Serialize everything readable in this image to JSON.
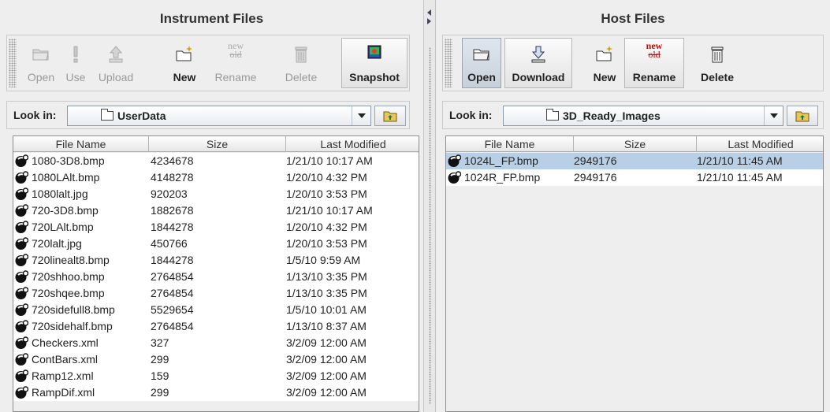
{
  "left_pane": {
    "title": "Instrument Files",
    "toolbar": {
      "open": "Open",
      "use": "Use",
      "upload": "Upload",
      "new": "New",
      "rename": "Rename",
      "rename_icon_new": "new",
      "rename_icon_old": "old",
      "delete": "Delete",
      "snapshot": "Snapshot"
    },
    "look_in_label": "Look in:",
    "look_in_value": "UserData",
    "table": {
      "columns": [
        "File Name",
        "Size",
        "Last Modified"
      ],
      "rows": [
        {
          "name": "1080-3D8.bmp",
          "size": "4234678",
          "modified": "1/21/10 10:17 AM"
        },
        {
          "name": "1080LAlt.bmp",
          "size": "4148278",
          "modified": "1/20/10 4:32 PM"
        },
        {
          "name": "1080lalt.jpg",
          "size": "920203",
          "modified": "1/20/10 3:53 PM"
        },
        {
          "name": "720-3D8.bmp",
          "size": "1882678",
          "modified": "1/21/10 10:17 AM"
        },
        {
          "name": "720LAlt.bmp",
          "size": "1844278",
          "modified": "1/20/10 4:32 PM"
        },
        {
          "name": "720lalt.jpg",
          "size": "450766",
          "modified": "1/20/10 3:53 PM"
        },
        {
          "name": "720linealt8.bmp",
          "size": "1844278",
          "modified": "1/5/10 9:59 AM"
        },
        {
          "name": "720shhoo.bmp",
          "size": "2764854",
          "modified": "1/13/10 3:35 PM"
        },
        {
          "name": "720shqee.bmp",
          "size": "2764854",
          "modified": "1/13/10 3:35 PM"
        },
        {
          "name": "720sidefull8.bmp",
          "size": "5529654",
          "modified": "1/5/10 10:01 AM"
        },
        {
          "name": "720sidehalf.bmp",
          "size": "2764854",
          "modified": "1/13/10 8:37 AM"
        },
        {
          "name": "Checkers.xml",
          "size": "327",
          "modified": "3/2/09 12:00 AM"
        },
        {
          "name": "ContBars.xml",
          "size": "299",
          "modified": "3/2/09 12:00 AM"
        },
        {
          "name": "Ramp12.xml",
          "size": "159",
          "modified": "3/2/09 12:00 AM"
        },
        {
          "name": "RampDif.xml",
          "size": "299",
          "modified": "3/2/09 12:00 AM"
        }
      ]
    }
  },
  "right_pane": {
    "title": "Host Files",
    "toolbar": {
      "open": "Open",
      "download": "Download",
      "new": "New",
      "rename": "Rename",
      "rename_icon_new": "new",
      "rename_icon_old": "old",
      "delete": "Delete"
    },
    "look_in_label": "Look in:",
    "look_in_value": "3D_Ready_Images",
    "table": {
      "columns": [
        "File Name",
        "Size",
        "Last Modified"
      ],
      "rows": [
        {
          "name": "1024L_FP.bmp",
          "size": "2949176",
          "modified": "1/21/10 11:45 AM",
          "selected": true
        },
        {
          "name": "1024R_FP.bmp",
          "size": "2949176",
          "modified": "1/21/10 11:45 AM",
          "selected": false
        }
      ]
    }
  },
  "icons": {
    "file": "file-icon",
    "folder": "folder-icon",
    "up_folder": "up-folder-icon"
  },
  "colors": {
    "selection": "#b8cfe5",
    "rename_new": "#cc0000"
  }
}
